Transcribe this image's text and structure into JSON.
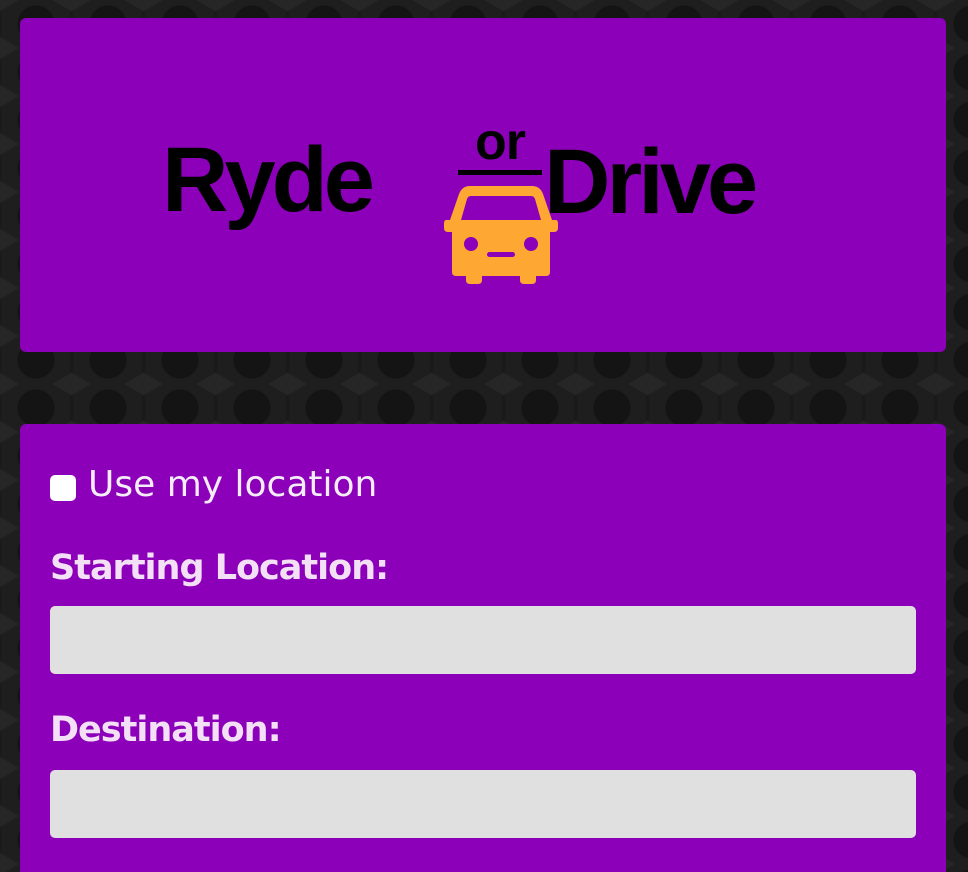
{
  "colors": {
    "panel": "#8b00b8",
    "accent": "#ffa733",
    "label_text": "#f4e0f6",
    "input_bg": "#e0e0e0"
  },
  "logo": {
    "word_left": "Ryde",
    "word_or": "or",
    "word_right": "Drive",
    "icon": "car-icon"
  },
  "form": {
    "use_location": {
      "label": "Use my location",
      "checked": false
    },
    "starting_location": {
      "label": "Starting Location:",
      "value": "",
      "placeholder": ""
    },
    "destination": {
      "label": "Destination:",
      "value": "",
      "placeholder": ""
    }
  }
}
